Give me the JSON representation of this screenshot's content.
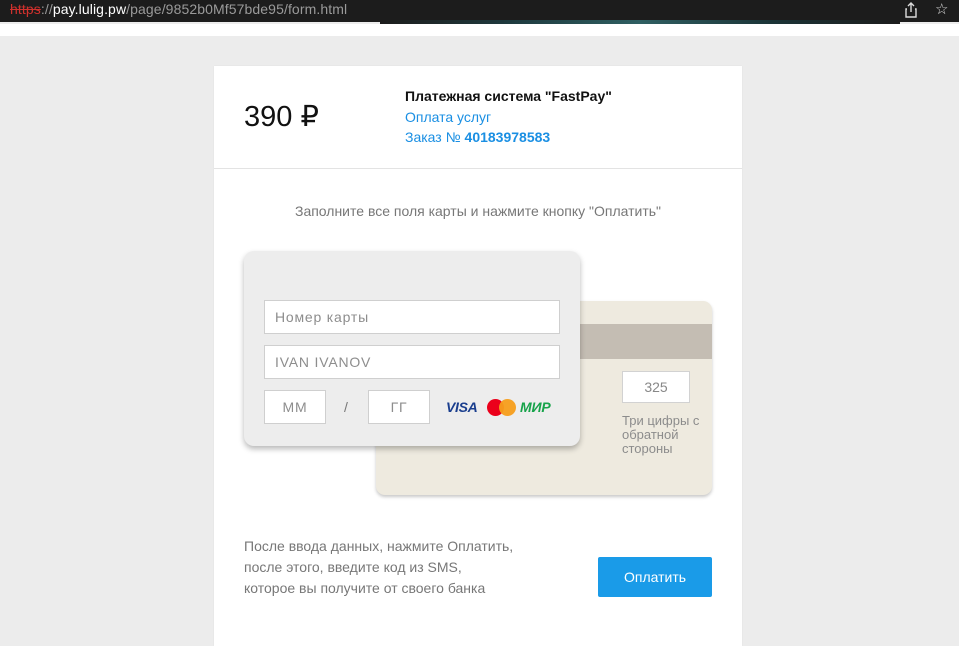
{
  "browser": {
    "url_protocol": "https",
    "url_separator": "://",
    "url_host": "pay.lulig.pw",
    "url_path": "/page/9852b0Mf57bde95/form.html",
    "share_icon": "share-icon",
    "bookmark_icon": "star-icon"
  },
  "header": {
    "amount": "390 ₽",
    "merchant": "Платежная система \"FastPay\"",
    "service": "Оплата услуг",
    "order_prefix": "Заказ № ",
    "order_number": "40183978583"
  },
  "instructions": "Заполните все поля карты и нажмите кнопку \"Оплатить\"",
  "card_front": {
    "card_number_placeholder": "Номер карты",
    "holder_placeholder": "IVAN IVANOV",
    "month_placeholder": "ММ",
    "separator": "/",
    "year_placeholder": "ГГ",
    "brands": [
      "VISA",
      "MasterCard",
      "МИР"
    ]
  },
  "card_back": {
    "cvv_placeholder": "325",
    "cvv_hint": "Три цифры с обратной стороны"
  },
  "footer": {
    "note": "После ввода данных, нажмите Оплатить, после этого, введите код из SMS, которое вы получите от своего банка",
    "pay_button": "Оплатить"
  },
  "colors": {
    "accent": "#1a9be8",
    "link": "#1a8fe3",
    "insecure_protocol": "#d0312d"
  }
}
